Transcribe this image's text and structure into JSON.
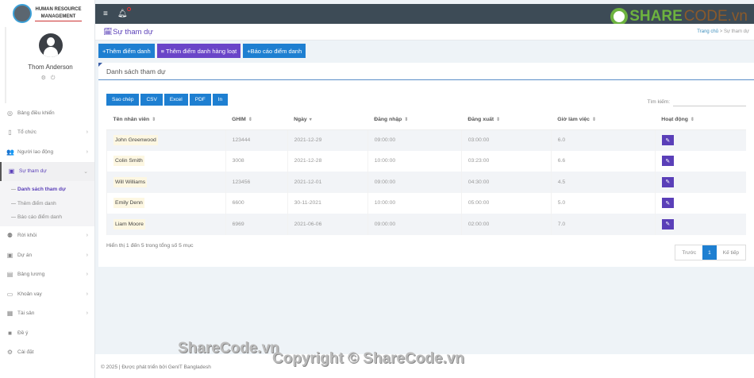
{
  "sidebar": {
    "logo_line1": "HUMAN RESOURCE",
    "logo_line2": "MANAGEMENT",
    "user": "Thom Anderson",
    "items": [
      {
        "label": "Bảng điều khiển",
        "icon": "dashboard-icon",
        "glyph": "◎"
      },
      {
        "label": "Tổ chức",
        "icon": "building-icon",
        "glyph": "▯",
        "chev": "›"
      },
      {
        "label": "Người lao động",
        "icon": "users-icon",
        "glyph": "👥",
        "chev": "›"
      },
      {
        "label": "Sự tham dự",
        "icon": "clipboard-icon",
        "glyph": "▣",
        "chev": "⌄"
      },
      {
        "label": "Rời khỏi",
        "icon": "user-leave-icon",
        "glyph": "⚉",
        "chev": "›"
      },
      {
        "label": "Dự án",
        "icon": "briefcase-icon",
        "glyph": "▣",
        "chev": "›"
      },
      {
        "label": "Bảng lương",
        "icon": "payroll-icon",
        "glyph": "▤",
        "chev": "›"
      },
      {
        "label": "Khoản vay",
        "icon": "money-icon",
        "glyph": "▭",
        "chev": "›"
      },
      {
        "label": "Tài sản",
        "icon": "grid-icon",
        "glyph": "▦",
        "chev": "›"
      },
      {
        "label": "Đề ý",
        "icon": "suggestion-icon",
        "glyph": "■"
      },
      {
        "label": "Cài đặt",
        "icon": "gear-icon",
        "glyph": "⚙"
      }
    ],
    "sub": [
      "Danh sách tham dự",
      "Thêm điểm danh",
      "Báo cáo điểm danh"
    ]
  },
  "header": {
    "title": "Sự tham dự",
    "crumb_home": "Trang chủ",
    "crumb_sep": ">",
    "crumb_current": "Sự tham dự"
  },
  "actions": [
    "+Thêm điểm danh",
    "≡ Thêm điểm danh hàng loạt",
    "+Báo cáo điểm danh"
  ],
  "card": {
    "title": "Danh sách tham dự",
    "exports": [
      "Sao chép",
      "CSV",
      "Excel",
      "PDF",
      "In"
    ],
    "search_label": "Tìm kiếm:",
    "search_value": "",
    "columns": [
      "Tên nhân viên",
      "GHIM",
      "Ngày",
      "Đăng nhập",
      "Đăng xuất",
      "Giờ làm việc",
      "Hoạt động"
    ],
    "rows": [
      [
        "John Greenwood",
        "123444",
        "2021-12-29",
        "09:00:00",
        "03:00:00",
        "6.0"
      ],
      [
        "Colin Smith",
        "3008",
        "2021-12-28",
        "10:00:00",
        "03:23:00",
        "6.6"
      ],
      [
        "Will Williams",
        "123456",
        "2021-12-01",
        "09:00:00",
        "04:30:00",
        "4.5"
      ],
      [
        "Emily Denn",
        "6600",
        "30-11-2021",
        "10:00:00",
        "05:00:00",
        "5.0"
      ],
      [
        "Liam Moore",
        "6969",
        "2021-06-06",
        "09:00:00",
        "02:00:00",
        "7.0"
      ]
    ],
    "info": "Hiển thị 1 đến 5 trong tổng số 5 mục",
    "prev": "Trước",
    "page": "1",
    "next": "Kế tiếp"
  },
  "footer": "© 2025 | Được phát triển bởi GenIT Bangladesh",
  "watermark": {
    "logo_a": "SHARE",
    "logo_b": "CODE.vn",
    "text1": "ShareCode.vn",
    "text2": "Copyright © ShareCode.vn"
  }
}
